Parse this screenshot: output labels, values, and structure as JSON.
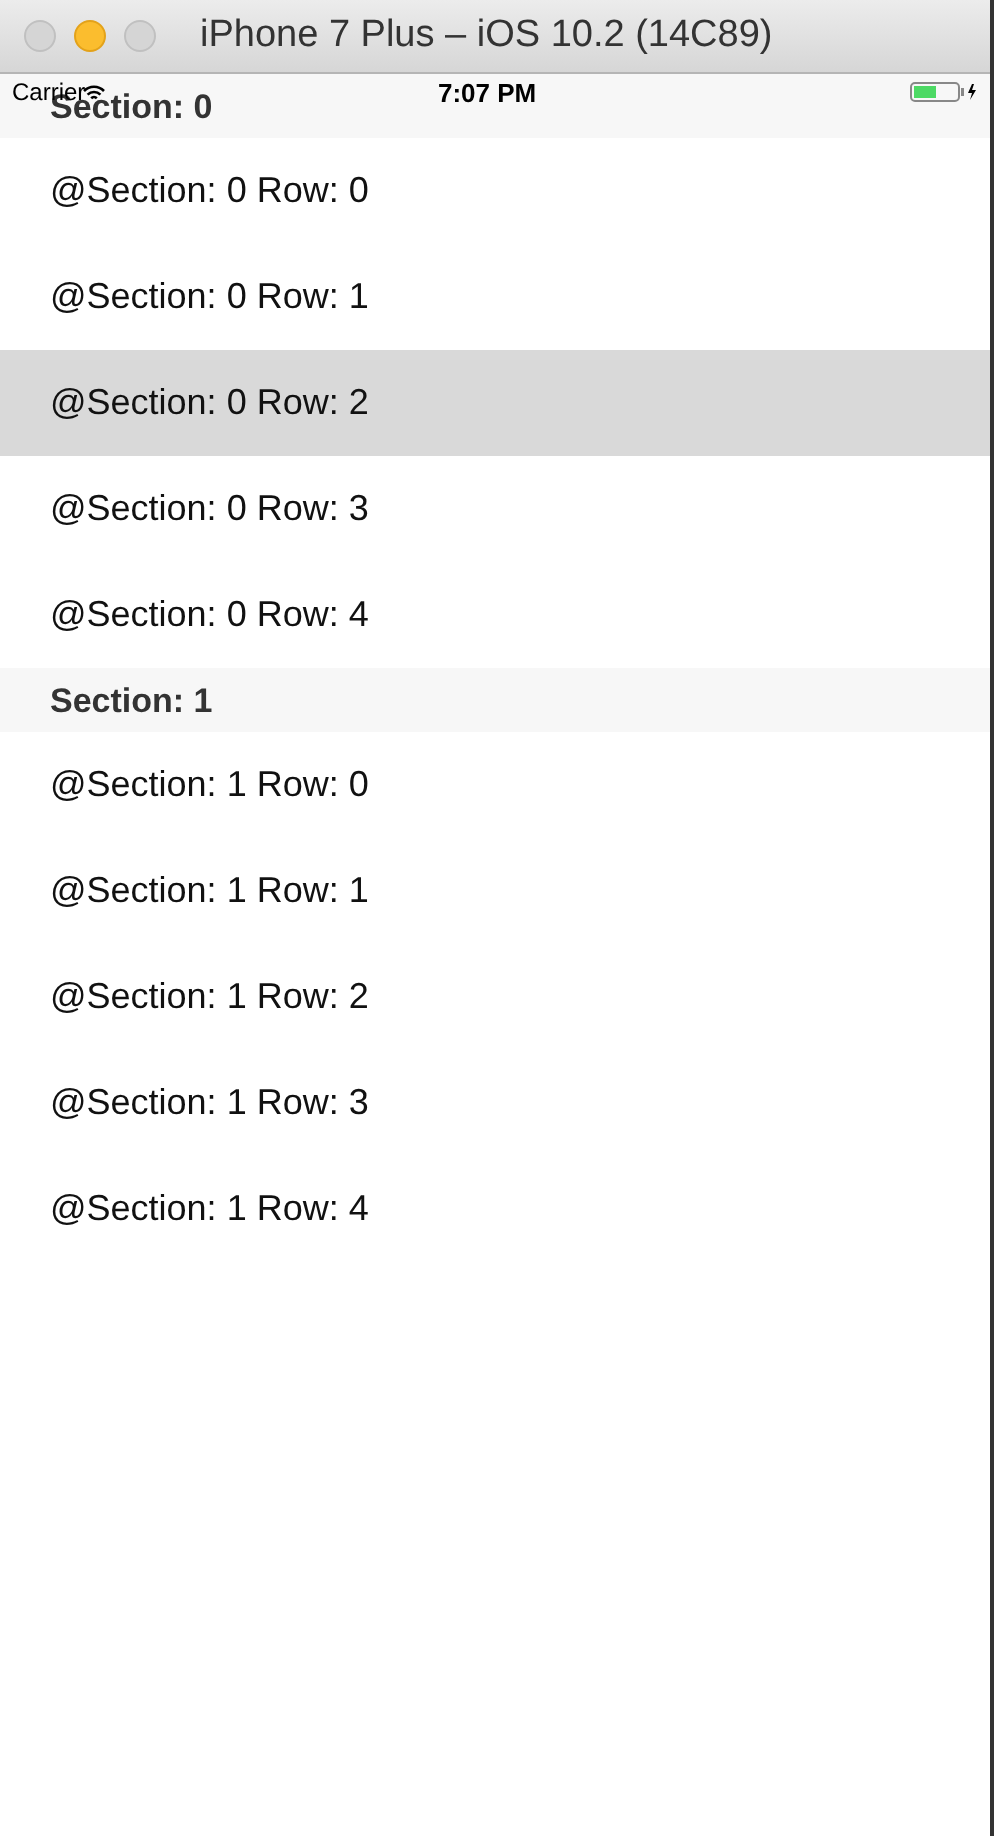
{
  "window": {
    "title": "iPhone 7 Plus – iOS 10.2 (14C89)"
  },
  "status_bar": {
    "carrier": "Carrier",
    "time": "7:07 PM"
  },
  "sections": [
    {
      "title": "Section: 0",
      "rows": [
        {
          "label": "@Section: 0 Row: 0",
          "selected": false
        },
        {
          "label": "@Section: 0 Row: 1",
          "selected": false
        },
        {
          "label": "@Section: 0 Row: 2",
          "selected": true
        },
        {
          "label": "@Section: 0 Row: 3",
          "selected": false
        },
        {
          "label": "@Section: 0 Row: 4",
          "selected": false
        }
      ]
    },
    {
      "title": "Section: 1",
      "rows": [
        {
          "label": "@Section: 1 Row: 0",
          "selected": false
        },
        {
          "label": "@Section: 1 Row: 1",
          "selected": false
        },
        {
          "label": "@Section: 1 Row: 2",
          "selected": false
        },
        {
          "label": "@Section: 1 Row: 3",
          "selected": false
        },
        {
          "label": "@Section: 1 Row: 4",
          "selected": false
        }
      ]
    }
  ]
}
